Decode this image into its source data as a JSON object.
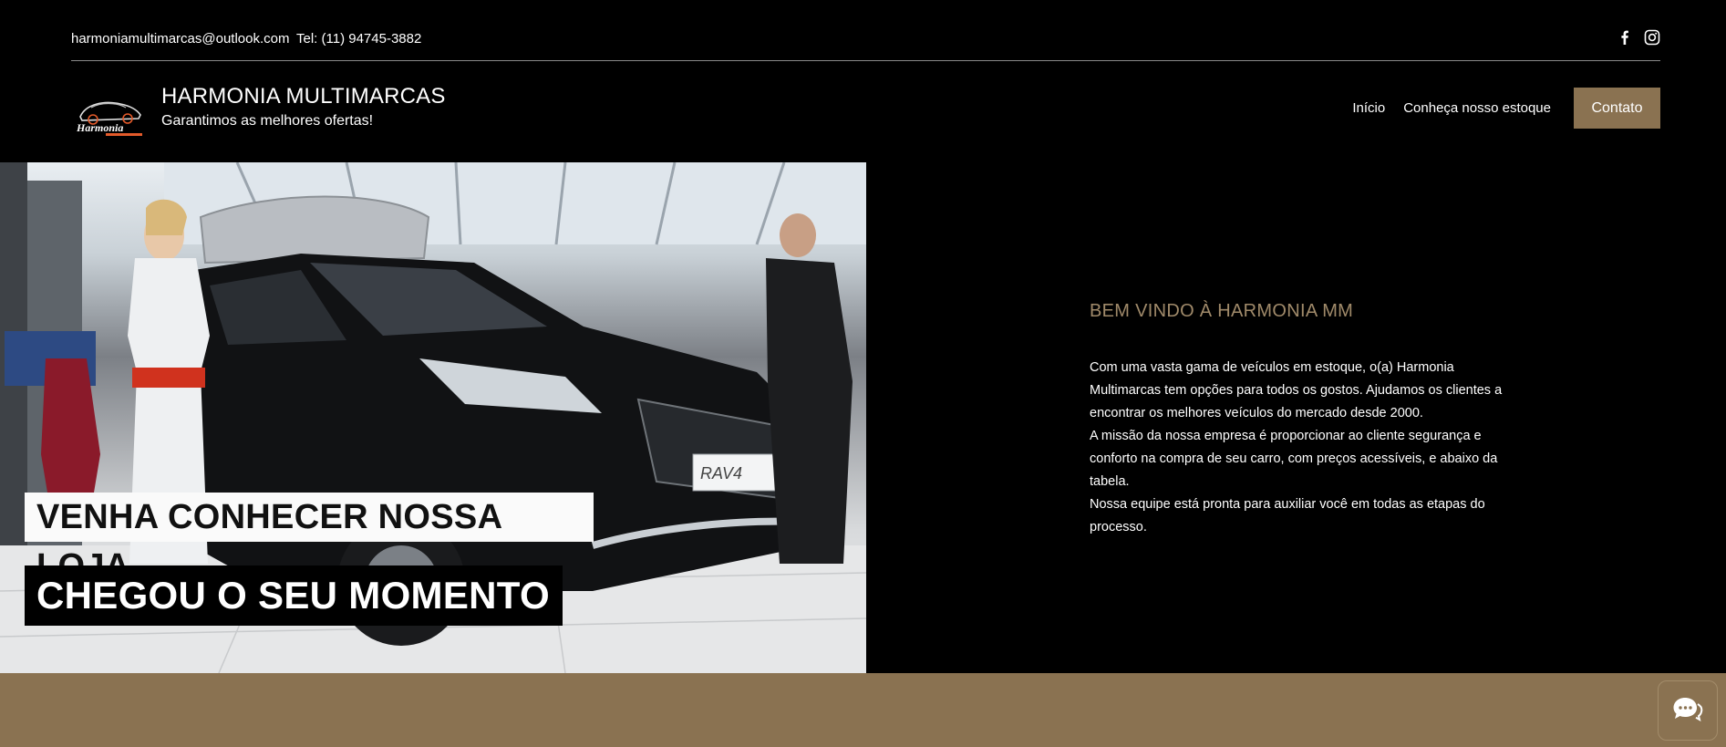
{
  "topbar": {
    "email": "harmoniamultimarcas@outlook.com",
    "phone": "Tel: (11) 94745-3882",
    "social_icons": [
      "facebook-icon",
      "instagram-icon"
    ]
  },
  "header": {
    "logo_text": "Harmonia",
    "title": "HARMONIA MULTIMARCAS",
    "tagline": "Garantimos as melhores ofertas!",
    "nav": {
      "home": "Início",
      "stock": "Conheça nosso estoque",
      "contact": "Contato"
    }
  },
  "hero": {
    "headline_1": "VENHA CONHECER NOSSA LOJA",
    "headline_2": "CHEGOU O SEU MOMENTO",
    "plate_text": "RAV4"
  },
  "welcome": {
    "title": "BEM VINDO À HARMONIA MM",
    "paragraph_1": "Com uma vasta gama de veículos em estoque, o(a) Harmonia Multimarcas tem opções para todos os gostos. Ajudamos os clientes a encontrar os melhores veículos do mercado desde 2000.",
    "paragraph_2": "A missão da nossa empresa é proporcionar ao cliente segurança e conforto na compra de seu carro, com preços acessíveis, e abaixo da tabela.",
    "paragraph_3": "Nossa equipe está pronta para auxiliar você em todas as etapas do processo."
  },
  "colors": {
    "accent": "#8a7251",
    "title_accent": "#a08a6a",
    "background": "#000000"
  },
  "chat": {
    "icon": "chat-bubble-icon"
  }
}
